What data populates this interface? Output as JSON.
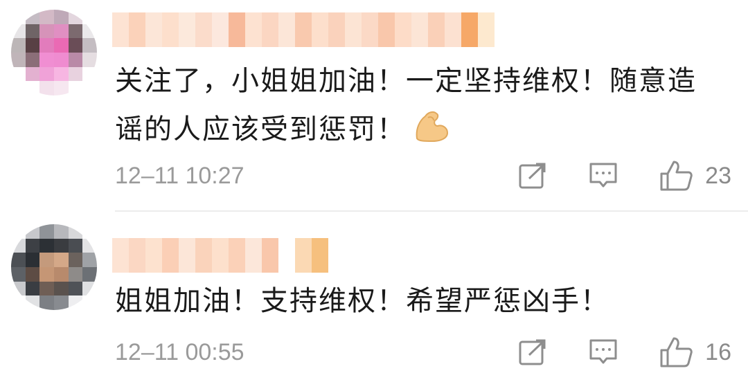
{
  "comments": [
    {
      "text": "关注了，小姐姐加油！一定坚持维权！随意造谣的人应该受到惩罚！",
      "emoji_icon": "flexed-biceps-icon",
      "time": "12–11 10:27",
      "likes": "23",
      "avatar_colors": [
        "#ffffff",
        "#c5bcc4",
        "#d3b9c6",
        "#bfa9b8",
        "#e3d6de",
        "#ffffff",
        "#e7e5e7",
        "#6f6466",
        "#d693b9",
        "#e08fc2",
        "#7c6a6f",
        "#eae8ea",
        "#bcb6b7",
        "#584044",
        "#e27cbc",
        "#ea6ab4",
        "#6a4d57",
        "#c4bdc2",
        "#c0b5b9",
        "#8b6e78",
        "#f08ed2",
        "#ef8cd0",
        "#b98aa7",
        "#e5dde1",
        "#ffffff",
        "#e3b1d0",
        "#f0a2d8",
        "#f7b6e2",
        "#e8d2df",
        "#ffffff",
        "#ffffff",
        "#ffffff",
        "#f3e1ec",
        "#f6e7f0",
        "#ffffff",
        "#ffffff"
      ],
      "username_colors": [
        "#fde3d3",
        "#fbd2ba",
        "#fce6d8",
        "#fddfcc",
        "#fce9dc",
        "#fbdccb",
        "#fce8de",
        "#f7b99a",
        "#fde2d1",
        "#fbd6c2",
        "#fce6d8",
        "#f9c9ae",
        "#fddfcc",
        "#fad2bc",
        "#fce4d4",
        "#fbd9c6",
        "#f9c7ab",
        "#fddcc8",
        "#fce5d6",
        "#fad0b8",
        "#fce1d1",
        "#f6a868",
        "#fde9cf"
      ]
    },
    {
      "text": "姐姐加油！支持维权！希望严惩凶手！",
      "time": "12–11 00:55",
      "likes": "16",
      "avatar_colors": [
        "#ffffff",
        "#c7c8cc",
        "#8f9398",
        "#b7b8bc",
        "#d8d8da",
        "#ffffff",
        "#d8d9dc",
        "#3d4045",
        "#2c3035",
        "#3a3c40",
        "#4a4d52",
        "#e3e3e5",
        "#4c5055",
        "#2b2f34",
        "#c49a7c",
        "#d4a888",
        "#6b625d",
        "#9fa2a6",
        "#5d6166",
        "#5d4c44",
        "#c59675",
        "#b88a6c",
        "#8e8b89",
        "#6c7075",
        "#c8c9cc",
        "#3a3d42",
        "#6f5e55",
        "#5a524e",
        "#4f5257",
        "#dfe0e2",
        "#ffffff",
        "#e1e2e4",
        "#7c7f84",
        "#888b90",
        "#eeeef0",
        "#ffffff"
      ],
      "username_colors": [
        "#fde3d3",
        "#fbd7c3",
        "#fde2cf",
        "#fbcfb6",
        "#fce6d8",
        "#fad3bb",
        "#fde0cc",
        "#fbd1b8",
        "#fce7da",
        "#f9c7ab",
        "#ffffff",
        "#fbd9b4",
        "#f6c07e"
      ]
    }
  ],
  "icons": {
    "share": "share-icon",
    "reply": "comment-icon",
    "like": "thumbs-up-icon"
  },
  "colors": {
    "text": "#1a1a1a",
    "meta": "#9a9a9a",
    "icon": "#8e8e8e",
    "divider": "#ececec"
  }
}
